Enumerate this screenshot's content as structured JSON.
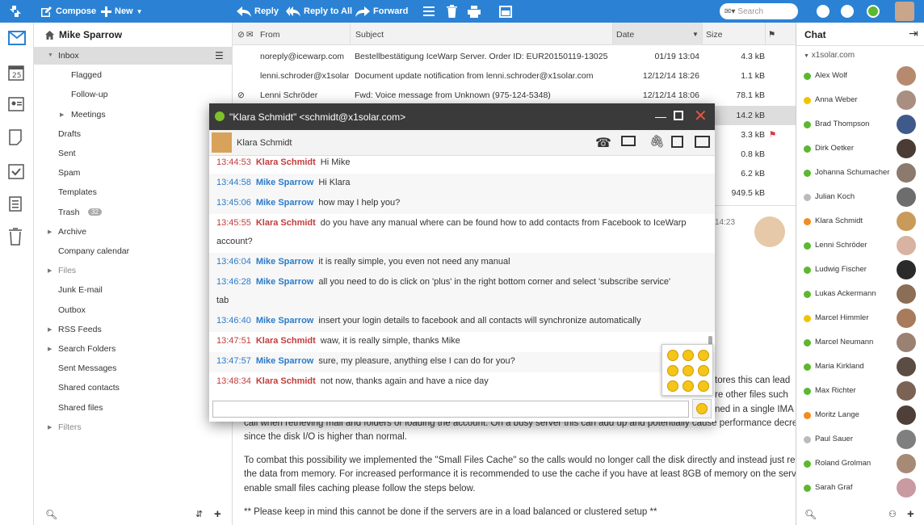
{
  "toolbar": {
    "compose": "Compose",
    "new": "New",
    "reply": "Reply",
    "reply_all": "Reply to All",
    "forward": "Forward",
    "search_placeholder": "Search"
  },
  "account": "Mike Sparrow",
  "folders": [
    {
      "label": "Inbox"
    },
    {
      "label": "Flagged"
    },
    {
      "label": "Follow-up"
    },
    {
      "label": "Meetings"
    },
    {
      "label": "Drafts"
    },
    {
      "label": "Sent"
    },
    {
      "label": "Spam"
    },
    {
      "label": "Templates"
    },
    {
      "label": "Trash",
      "badge": "32"
    },
    {
      "label": "Archive"
    },
    {
      "label": "Company calendar"
    },
    {
      "label": "Files"
    },
    {
      "label": "Junk E-mail"
    },
    {
      "label": "Outbox"
    },
    {
      "label": "RSS Feeds"
    },
    {
      "label": "Search Folders"
    },
    {
      "label": "Sent Messages"
    },
    {
      "label": "Shared contacts"
    },
    {
      "label": "Shared files"
    },
    {
      "label": "Filters"
    }
  ],
  "list_columns": {
    "from": "From",
    "subject": "Subject",
    "date": "Date",
    "size": "Size"
  },
  "messages": [
    {
      "from": "noreply@icewarp.com",
      "subject": "Bestellbestätigung IceWarp Server. Order ID: EUR20150119-13025",
      "date": "01/19 13:04",
      "size": "4.3 kB"
    },
    {
      "from": "lenni.schroder@x1solar.c",
      "subject": "Document update notification from lenni.schroder@x1solar.com",
      "date": "12/12/14 18:26",
      "size": "1.1 kB"
    },
    {
      "from": "Lenni Schröder",
      "subject": "Fwd: Voice message from Unknown (975-124-5348)",
      "date": "12/12/14 18:06",
      "size": "78.1 kB"
    },
    {
      "from": "",
      "subject": "",
      "date": "",
      "size": "14.2 kB"
    },
    {
      "from": "",
      "subject": "",
      "date": "",
      "size": "3.3 kB"
    },
    {
      "from": "",
      "subject": "",
      "date": "",
      "size": "0.8 kB"
    },
    {
      "from": "",
      "subject": "",
      "date": "",
      "size": "6.2 kB"
    },
    {
      "from": "",
      "subject": "",
      "date": "",
      "size": "949.5 kB"
    }
  ],
  "preview": {
    "time_fragment": "14:23",
    "lines": [
      "tores this can lead",
      "re other files such",
      "ned in a single IMA",
      "call when retrieving mail and folders or loading the account.  On a busy server this can add up and potentially cause performance decreases",
      "since the disk I/O is higher than normal.",
      "To combat this possibility we implemented the \"Small Files Cache\" so the calls would no longer call the disk directly and instead just receive",
      "the data from memory.  For increased performance it is recommended to use the cache if you have at least 8GB of memory on the server.",
      "enable small files caching please follow the steps below.",
      "** Please keep in mind this cannot be done if the servers are in a load balanced or clustered setup **"
    ]
  },
  "chat_dialog": {
    "title": "\"Klara Schmidt\" <schmidt@x1solar.com>",
    "contact": "Klara Schmidt",
    "messages": [
      {
        "time": "13:44:53",
        "name": "Klara Schmidt",
        "who": "them",
        "text": "Hi Mike"
      },
      {
        "time": "13:44:58",
        "name": "Mike Sparrow",
        "who": "me",
        "text": "Hi Klara"
      },
      {
        "time": "13:45:06",
        "name": "Mike Sparrow",
        "who": "me",
        "text": "how may I help you?"
      },
      {
        "time": "13:45:55",
        "name": "Klara Schmidt",
        "who": "them",
        "text": "do you have any manual where can be found how to add contacts from Facebook to IceWarp",
        "text2": "account?"
      },
      {
        "time": "13:46:04",
        "name": "Mike Sparrow",
        "who": "me",
        "text": "it is really simple, you even not need any manual"
      },
      {
        "time": "13:46:28",
        "name": "Mike Sparrow",
        "who": "me",
        "text": "all you need to do is click on 'plus' in the right bottom corner and select 'subscribe service'",
        "text2": "tab"
      },
      {
        "time": "13:46:40",
        "name": "Mike Sparrow",
        "who": "me",
        "text": "insert your login details to facebook and all contacts will synchronize automatically"
      },
      {
        "time": "13:47:51",
        "name": "Klara Schmidt",
        "who": "them",
        "text": "waw, it is really simple, thanks Mike"
      },
      {
        "time": "13:47:57",
        "name": "Mike Sparrow",
        "who": "me",
        "text": "sure, my pleasure, anything else I can do for you?"
      },
      {
        "time": "13:48:34",
        "name": "Klara Schmidt",
        "who": "them",
        "text": "not now, thanks again and have a nice day"
      }
    ]
  },
  "chat": {
    "title": "Chat",
    "group": "x1solar.com",
    "contacts": [
      {
        "name": "Alex Wolf",
        "status": "#5cb82e"
      },
      {
        "name": "Anna Weber",
        "status": "#f2c300"
      },
      {
        "name": "Brad Thompson",
        "status": "#5cb82e"
      },
      {
        "name": "Dirk Oetker",
        "status": "#5cb82e"
      },
      {
        "name": "Johanna Schumacher",
        "status": "#5cb82e"
      },
      {
        "name": "Julian Koch",
        "status": "#bbbbbb"
      },
      {
        "name": "Klara Schmidt",
        "status": "#f28c1f"
      },
      {
        "name": "Lenni Schröder",
        "status": "#5cb82e"
      },
      {
        "name": "Ludwig Fischer",
        "status": "#5cb82e"
      },
      {
        "name": "Lukas Ackermann",
        "status": "#5cb82e"
      },
      {
        "name": "Marcel Himmler",
        "status": "#f2c300"
      },
      {
        "name": "Marcel Neumann",
        "status": "#5cb82e"
      },
      {
        "name": "Maria Kirkland",
        "status": "#5cb82e"
      },
      {
        "name": "Max Richter",
        "status": "#5cb82e"
      },
      {
        "name": "Moritz Lange",
        "status": "#f28c1f"
      },
      {
        "name": "Paul Sauer",
        "status": "#bbbbbb"
      },
      {
        "name": "Roland Grolman",
        "status": "#5cb82e"
      },
      {
        "name": "Sarah Graf",
        "status": "#5cb82e"
      }
    ]
  },
  "colors": {
    "accent": "#2b82d4",
    "me": "#2b7bc9",
    "them": "#c43b3b",
    "selected_row": "#ddd"
  }
}
